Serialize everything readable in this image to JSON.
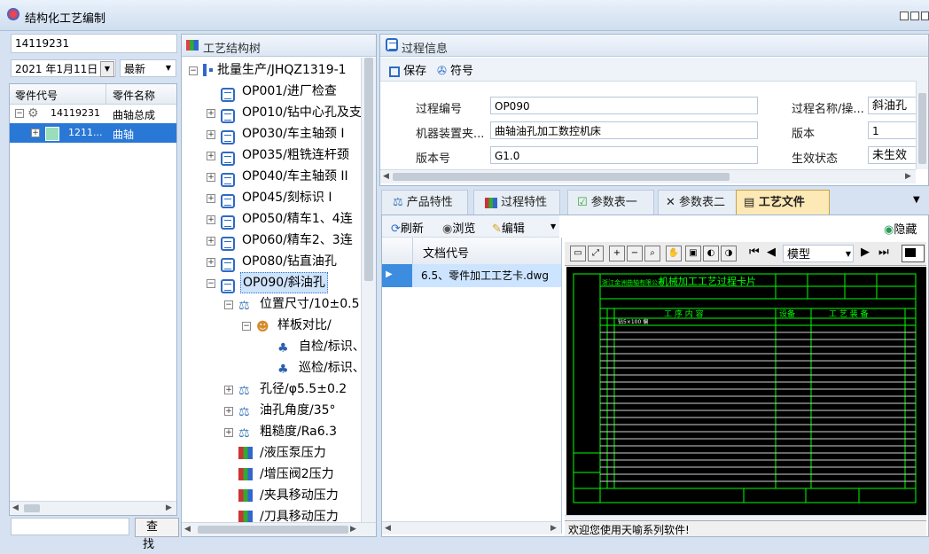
{
  "window": {
    "title": "结构化工艺编制"
  },
  "left": {
    "search_value": "14119231",
    "date_value": "2021 年1月11日",
    "version_select": "最新",
    "columns": [
      "零件代号",
      "零件名称"
    ],
    "rows": [
      {
        "code": "14119231",
        "name": "曲轴总成"
      },
      {
        "code": "1211...",
        "name": "曲轴"
      }
    ],
    "query_button": "查",
    "query_button2": "找"
  },
  "tree": {
    "header": "工艺结构树",
    "items": [
      {
        "label": "批量生产/JHQZ1319-1"
      },
      {
        "label": "OP001/进厂检查"
      },
      {
        "label": "OP010/钻中心孔及支"
      },
      {
        "label": "OP030/车主轴颈 I"
      },
      {
        "label": "OP035/粗铣连杆颈"
      },
      {
        "label": "OP040/车主轴颈 II"
      },
      {
        "label": "OP045/刻标识 I"
      },
      {
        "label": "OP050/精车1、4连"
      },
      {
        "label": "OP060/精车2、3连"
      },
      {
        "label": "OP080/钻直油孔"
      },
      {
        "label": "OP090/斜油孔"
      },
      {
        "label": "位置尺寸/10±0.5"
      },
      {
        "label": "样板对比/"
      },
      {
        "label": "自检/标识、"
      },
      {
        "label": "巡检/标识、"
      },
      {
        "label": "孔径/φ5.5±0.2"
      },
      {
        "label": "油孔角度/35°"
      },
      {
        "label": "粗糙度/Ra6.3"
      },
      {
        "label": "/液压泵压力"
      },
      {
        "label": "/增压阀2压力"
      },
      {
        "label": "/夹具移动压力"
      },
      {
        "label": "/刀具移动压力"
      }
    ]
  },
  "process": {
    "header": "过程信息",
    "save": "保存",
    "symbol": "符号",
    "fields": {
      "code_label": "过程编号",
      "code_value": "OP090",
      "device_label": "机器装置夹...",
      "device_value": "曲轴油孔加工数控机床",
      "ver_label": "版本号",
      "ver_value": "G1.0",
      "name_label": "过程名称/操...",
      "name_value": "斜油孔",
      "version_label": "版本",
      "version_value": "1",
      "status_label": "生效状态",
      "status_value": "未生效"
    }
  },
  "tabs": [
    "产品特性",
    "过程特性",
    "参数表一",
    "参数表二",
    "工艺文件"
  ],
  "doc": {
    "refresh": "刷新",
    "browse": "浏览",
    "edit": "编辑",
    "column": "文档代号",
    "file": "6.5、零件加工工艺卡.dwg",
    "hide": "隐藏",
    "model_select": "模型"
  },
  "cad": {
    "company": "浙江金洲曲轴有限公司",
    "card_title": "机械加工工艺过程卡片",
    "col_work": "工 序 内 容",
    "col_device": "设备",
    "col_equip": "工 艺 装 备",
    "row1": "钻5×100 偏"
  },
  "status": {
    "text": "欢迎您使用天喻系列软件!"
  },
  "colors": {
    "accent": "#3c7fd6",
    "selected": "#2a78d6",
    "cad_bg": "#000000",
    "cad_line": "#00ff00"
  }
}
